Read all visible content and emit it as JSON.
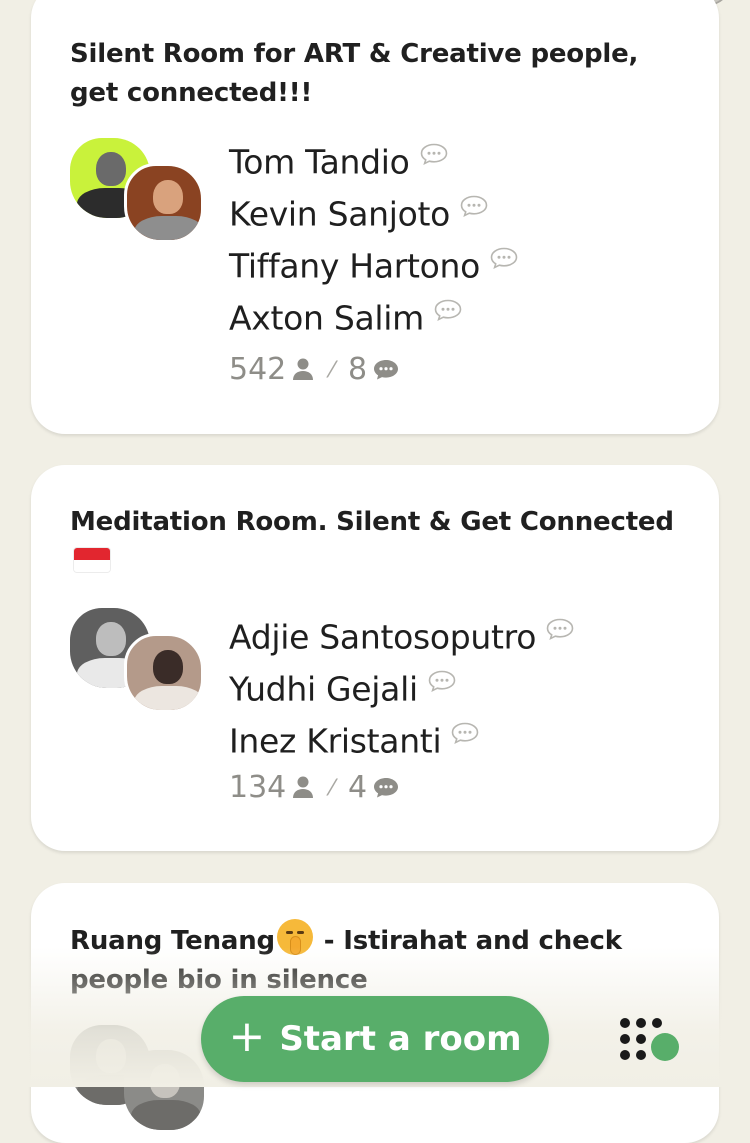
{
  "rooms": [
    {
      "title": "Silent Room for ART & Creative people, get connected!!!",
      "speakers": [
        "Tom Tandio",
        "Kevin Sanjoto",
        "Tiffany Hartono",
        "Axton Salim"
      ],
      "listeners": "542",
      "speakers_count": "8"
    },
    {
      "title": "Meditation Room. Silent & Get Connected",
      "title_emoji": "indonesia-flag",
      "speakers": [
        "Adjie Santosoputro",
        "Yudhi Gejali",
        "Inez Kristanti"
      ],
      "listeners": "134",
      "speakers_count": "4"
    },
    {
      "title_before_emoji": "Ruang Tenang",
      "title_emoji": "shushing-face",
      "title_after_emoji": " - Istirahat and check people bio in silence"
    }
  ],
  "actions": {
    "start_room_label": "Start a room",
    "start_room_icon": "plus-icon",
    "backchannel_icon": "dot-grid-icon"
  },
  "colors": {
    "background": "#f1efe5",
    "card": "#ffffff",
    "accent_green": "#58ae6a",
    "muted_text": "#8e8d88"
  }
}
